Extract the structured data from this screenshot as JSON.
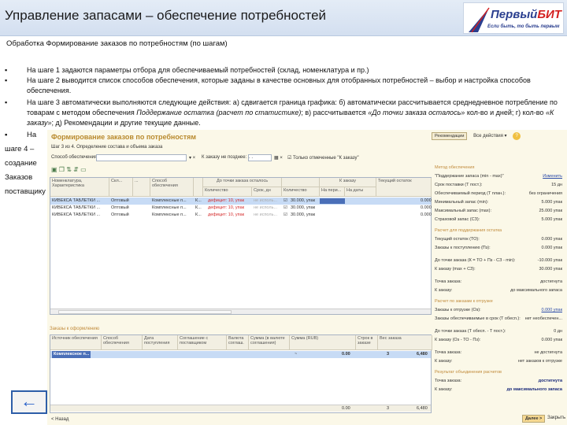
{
  "slide": {
    "title": "Управление запасами – обеспечение потребностей",
    "subtitle": "Обработка Формирование заказов по потребностям (по шагам)",
    "bullets": [
      {
        "marker": "▪",
        "text": "На шаге 1 задаются параметры отбора для обеспечиваемый потребностей (склад, номенклатура и пр.)"
      },
      {
        "marker": "▪",
        "text": "На шаге 2 выводится список способов обеспечения, которые заданы в качестве основных для отобранных потребностей – выбор и настройка способов обеспечения."
      },
      {
        "marker": "▪",
        "t1": "На шаге 3 автоматически выполняются следующие действия: а) сдвигается граница графика: б) автоматически рассчитывается среднедневное потребление по товарам с методом обеспечения ",
        "t2": "Поддержание остатка (расчет по статистике)",
        "t3": "; в) рассчитывается ",
        "t4": "«До точки заказа осталось»",
        "t5": " кол-во и дней; г) кол-во ",
        "t6": "«К заказу»",
        "t7": "; д) Рекомендации и другие текущие данные."
      }
    ],
    "step4": {
      "marker": "▪",
      "lines": [
        "На",
        "шаге 4 –",
        "создание",
        "Заказов",
        "поставщику"
      ]
    },
    "back_icon": "arrow-left-icon"
  },
  "logo": {
    "name": "ПервыйБИТ",
    "name_a": "Первый",
    "name_b": "БИТ",
    "slogan": "Если быть, то быть первым"
  },
  "window": {
    "title": "Формирование заказов по потребностям",
    "step": "Шаг 3 из 4. Определение состава и объема заказа",
    "filter": {
      "method_label": "Способ обеспечения:",
      "method_value": "",
      "order_label": "К заказу не позднее:",
      "order_value": ". .",
      "only_label": "Только отмеченные \"К заказу\""
    },
    "buttons": {
      "recommend": "Рекомендации",
      "all_actions": "Все действия ▾",
      "help": "?",
      "next": "Далее >",
      "close": "Закрыть",
      "back": "< Назад"
    },
    "table": {
      "headers": [
        "Номенклатура, Характеристика",
        "Скл...",
        "...",
        "Способ обеспечения",
        "",
        "До точки заказа осталось",
        "Количество",
        "Срок, дн",
        "",
        "К заказу",
        "Количество",
        "На пери...",
        "На даты",
        "Текущий остаток"
      ],
      "rows": [
        {
          "item": "КИВЕКСА ТАБЛЕТКИ ...",
          "stock": "Оптовый",
          "method": "Комплексные п...",
          "k": "К...",
          "qty": "дефицит: 10, упак",
          "days": "не исполь...",
          "order": "30.000, упак",
          "rest": "0.000"
        },
        {
          "item": "КИВЕКСА ТАБЛЕТКИ ...",
          "stock": "Оптовый",
          "method": "Комплексные п...",
          "k": "К...",
          "qty": "дефицит: 10, упак",
          "days": "не исполь...",
          "order": "30.000, упак",
          "rest": "0.000"
        },
        {
          "item": "КИВЕКСА ТАБЛЕТКИ ...",
          "stock": "Оптовый",
          "method": "Комплексные п...",
          "k": "К...",
          "qty": "дефицит: 10, упак",
          "days": "не исполь...",
          "order": "30.000, упак",
          "rest": "0.000"
        }
      ]
    },
    "orders": {
      "label": "Заказы к оформлению",
      "headers": [
        "Источник обеспечения",
        "Способ обеспечения",
        "Дата поступления",
        "Соглашение с поставщиком",
        "Валюта соглаш.",
        "Сумма (в валюте соглашения)",
        "Сумма (RUB)",
        "Строк в заказе",
        "Вес заказа"
      ],
      "row": {
        "source": "Комплексное п...",
        "sum_rub": "0.00",
        "lines": "3",
        "weight": "6,480",
        "approx": "~"
      },
      "totals": {
        "sum_rub": "0.00",
        "lines": "3",
        "weight": "6,480"
      }
    },
    "panel": [
      {
        "type": "sec",
        "label": "Метод обеспечения"
      },
      {
        "label": "\"Поддержание запаса (min - max)\"",
        "value": "Изменить",
        "link": true
      },
      {
        "label": "Срок поставки (Т пост.):",
        "value": "15 дн"
      },
      {
        "label": "Обеспечиваемый период (Т план.):",
        "value": "без ограничения"
      },
      {
        "label": "Минимальный запас (min):",
        "value": "5.000 упак"
      },
      {
        "label": "Максимальный запас (max):",
        "value": "25.000 упак"
      },
      {
        "label": "Страховой запас (СЗ):",
        "value": "5.000 упак"
      },
      {
        "type": "sec",
        "label": "Расчет для поддержания остатка"
      },
      {
        "label": "Текущий остаток (ТО):",
        "value": "0.000 упак"
      },
      {
        "label": "Заказы к поступлению (Пз):",
        "value": "0.000 упак"
      },
      {
        "type": "gap"
      },
      {
        "label": "До точки заказа (К = ТО + Пз - СЗ - min):",
        "value": "-10.000 упак"
      },
      {
        "label": "К заказу (max + СЗ):",
        "value": "30.000 упак"
      },
      {
        "type": "gap"
      },
      {
        "label": "Точка заказа:",
        "value": "достигнута"
      },
      {
        "label": "К заказу:",
        "value": "до максимального запаса"
      },
      {
        "type": "sec",
        "label": "Расчет по заказам к отгрузке"
      },
      {
        "label": "Заказы к отгрузке (Оз):",
        "value": "0.000 упак",
        "link": true
      },
      {
        "label": "Заказы обеспечиваемые в срок (Т обесп.):",
        "value": "нет необеспечен..."
      },
      {
        "type": "gap"
      },
      {
        "label": "До точки заказа (Т обесп. - Т пост.):",
        "value": "0 дн"
      },
      {
        "label": "К заказу (Оз - ТО - Пз):",
        "value": "0.000 упак"
      },
      {
        "type": "gap"
      },
      {
        "label": "Точка заказа:",
        "value": "не достигнута"
      },
      {
        "label": "К заказу:",
        "value": "нет заказов к отгрузке"
      },
      {
        "type": "sec",
        "label": "Результат объединения расчетов"
      },
      {
        "label": "Точка заказа:",
        "value": "достигнута",
        "bold": true
      },
      {
        "label": "К заказу:",
        "value": "до максимального запаса",
        "bold": true
      }
    ]
  },
  "colors": {
    "titlebar": "#d9e3f0",
    "window_bg": "#fbf8e8",
    "window_title": "#b98a2e",
    "selection": "#c7dbf5",
    "deficit": "#d42a2a"
  }
}
